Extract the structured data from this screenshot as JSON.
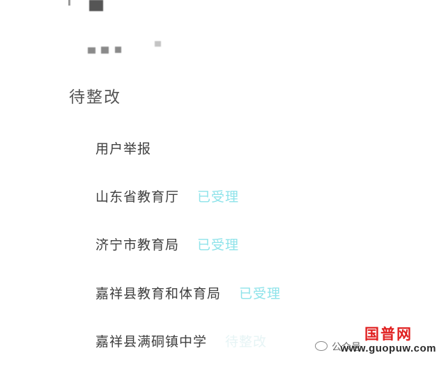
{
  "progress": {
    "heading": "待整改",
    "steps": [
      {
        "label": "用户举报",
        "status": ""
      },
      {
        "label": "山东省教育厅",
        "status": "已受理"
      },
      {
        "label": "济宁市教育局",
        "status": "已受理"
      },
      {
        "label": "嘉祥县教育和体育局",
        "status": "已受理"
      },
      {
        "label": "嘉祥县满硐镇中学",
        "status": "待整改"
      }
    ]
  },
  "watermark": {
    "wechat": "公众号",
    "brand": "国普网",
    "url": "www.guopuw.com"
  },
  "colors": {
    "accepted": "#8ee3ea",
    "brand": "#e02020"
  }
}
